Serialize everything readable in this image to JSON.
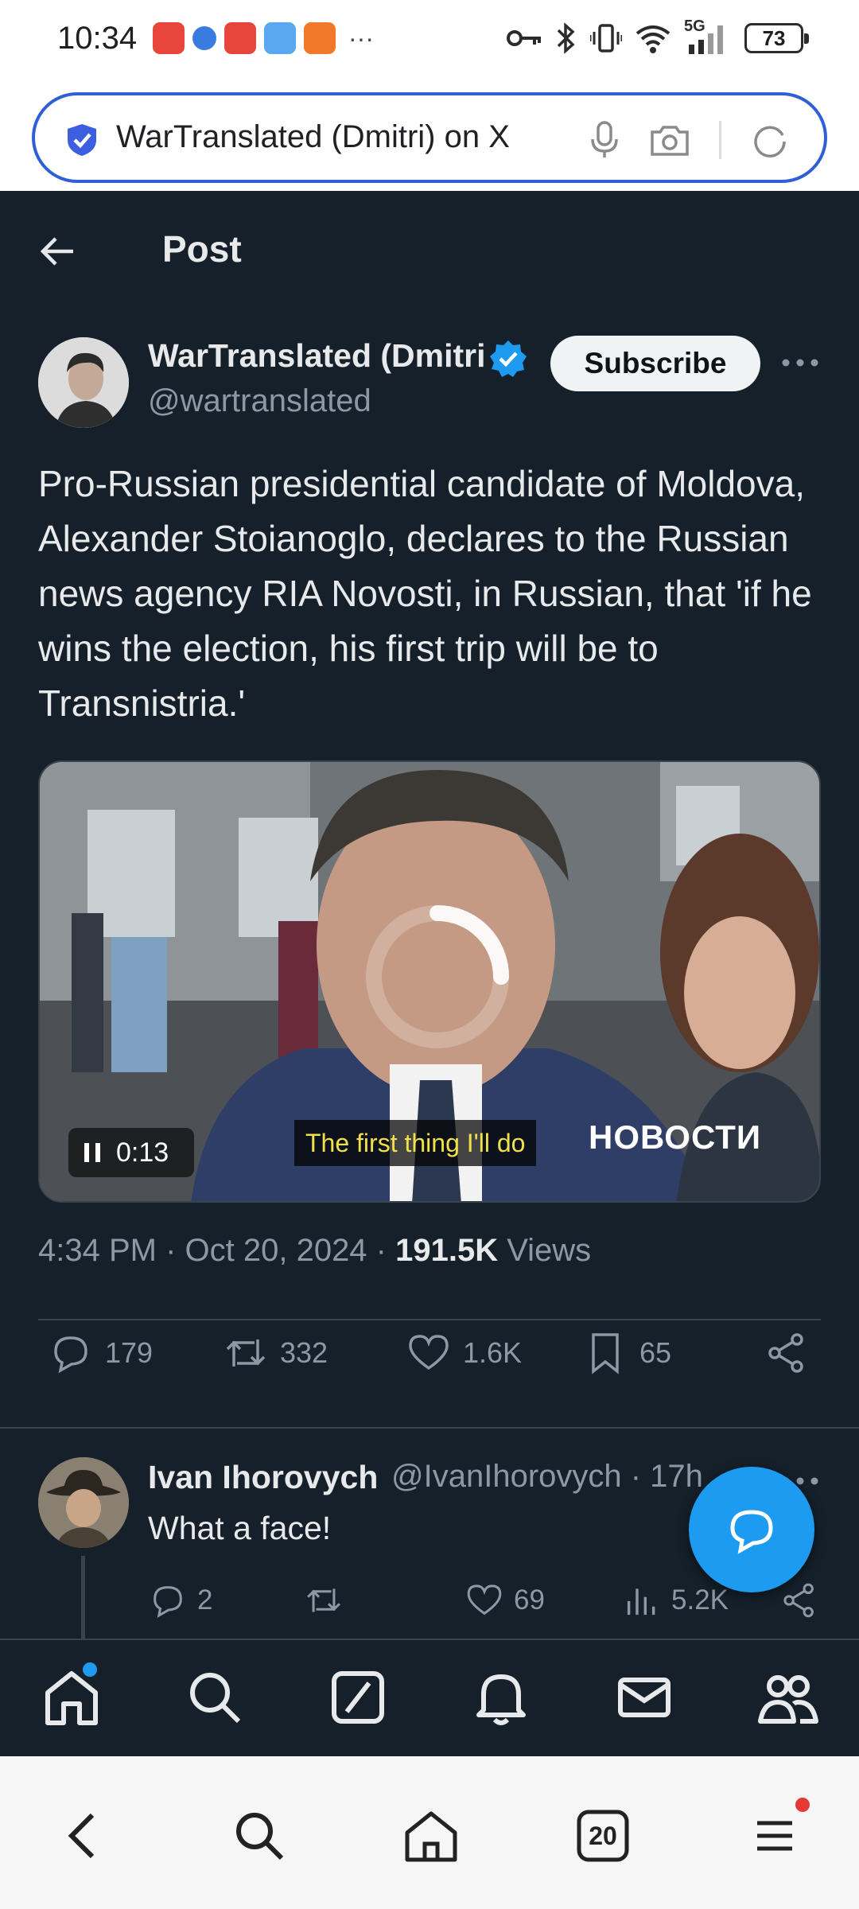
{
  "status_bar": {
    "time": "10:34",
    "network": "5G",
    "battery": "73"
  },
  "browser": {
    "address_text": "WarTranslated (Dmitri) on X",
    "tab_count": "20"
  },
  "header": {
    "title": "Post"
  },
  "post": {
    "author_name": "WarTranslated (Dmitri)",
    "author_handle": "@wartranslated",
    "subscribe_label": "Subscribe",
    "text": "Pro-Russian presidential candidate of Moldova, Alexander Stoianoglo, declares to the Russian news agency RIA Novosti, in Russian, that 'if he wins the election, his first trip will be to Transnistria.'",
    "video": {
      "time": "0:13",
      "caption": "The first thing I'll do",
      "watermark": "НОВОСТИ"
    },
    "timestamp": "4:34 PM · Oct 20, 2024 · ",
    "views_count": "191.5K",
    "views_label": " Views",
    "stats": {
      "replies": "179",
      "reposts": "332",
      "likes": "1.6K",
      "bookmarks": "65"
    }
  },
  "reply": {
    "author_name": "Ivan Ihorovych",
    "author_handle": "@IvanIhorovych · 17h",
    "text": "What a face!",
    "stats": {
      "replies": "2",
      "likes": "69",
      "views": "5.2K"
    }
  },
  "colors": {
    "background": "#15202b",
    "accent": "#1d9bf0",
    "secondary_text": "#8b98a5",
    "caption_text": "#f0e04a"
  },
  "icons": {
    "tabbar": [
      "home-icon",
      "search-icon",
      "grok-icon",
      "notifications-icon",
      "messages-icon",
      "communities-icon"
    ],
    "browser_nav": [
      "back-icon",
      "search-icon",
      "home-icon",
      "tabs-icon",
      "menu-icon"
    ]
  }
}
